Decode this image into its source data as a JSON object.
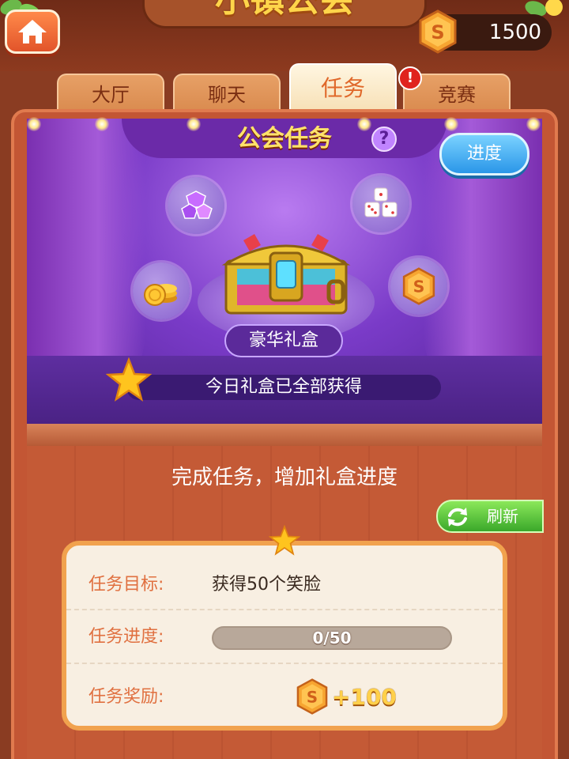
{
  "header": {
    "title": "小镇公会",
    "coins": "1500",
    "home_icon": "home-icon",
    "coin_icon": "coin-icon"
  },
  "tabs": [
    {
      "label": "大厅",
      "active": false
    },
    {
      "label": "聊天",
      "active": false
    },
    {
      "label": "任务",
      "active": true
    },
    {
      "label": "竞赛",
      "active": false,
      "alert": true
    }
  ],
  "alert_badge": "!",
  "stage": {
    "title": "公会任务",
    "help": "?",
    "progress_button": "进度",
    "gift_name": "豪华礼盒",
    "status": "今日礼盒已全部获得",
    "rewards_icons": [
      "gem-icon",
      "dice-icon",
      "gold-coins-icon",
      "coin-icon"
    ]
  },
  "task_section": {
    "subtitle": "完成任务，增加礼盒进度",
    "refresh_label": "刷新"
  },
  "task_card": {
    "goal_label": "任务目标:",
    "goal_value": "获得50个笑脸",
    "progress_label": "任务进度:",
    "progress_text": "0/50",
    "progress_current": 0,
    "progress_total": 50,
    "reward_label": "任务奖励:",
    "reward_value": "+100"
  },
  "colors": {
    "accent": "#e0682a",
    "coin": "#f7a531",
    "stage_purple": "#7a3bc8",
    "refresh_green": "#3aa82a",
    "progress_blue": "#2a96e8"
  }
}
